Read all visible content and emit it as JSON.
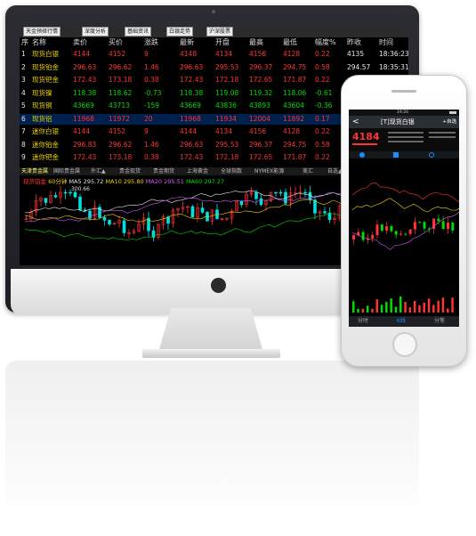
{
  "toolbar": {
    "buttons": [
      "天金预择行情",
      "深度分析",
      "基础资讯",
      "白银走势",
      "沪深股票"
    ]
  },
  "table": {
    "headers": [
      "序",
      "名称",
      "卖价",
      "买价",
      "涨跌",
      "最新",
      "开盘",
      "最高",
      "最低",
      "幅度%",
      "昨收",
      "时间"
    ],
    "rows": [
      {
        "idx": "1",
        "name": "现货白银",
        "ask": "4144",
        "bid": "4152",
        "chg": "9",
        "last": "4148",
        "open": "4134",
        "high": "4156",
        "low": "4128",
        "pct": "0.22",
        "prev": "4135",
        "time": "18:36:23"
      },
      {
        "idx": "2",
        "name": "现货铂金",
        "ask": "296.63",
        "bid": "296.62",
        "chg": "1.46",
        "last": "296.63",
        "open": "295.53",
        "high": "296.37",
        "low": "294.75",
        "pct": "0.58",
        "prev": "294.57",
        "time": "18:35:31"
      },
      {
        "idx": "3",
        "name": "现货钯金",
        "ask": "172.43",
        "bid": "173.18",
        "chg": "0.38",
        "last": "172.43",
        "open": "172.18",
        "high": "172.65",
        "low": "171.87",
        "pct": "0.22",
        "prev": "",
        "time": ""
      },
      {
        "idx": "4",
        "name": "现货镍",
        "ask": "118.38",
        "bid": "118.62",
        "chg": "-0.73",
        "last": "118.38",
        "open": "119.08",
        "high": "119.32",
        "low": "118.06",
        "pct": "-0.61",
        "prev": "",
        "time": ""
      },
      {
        "idx": "5",
        "name": "现货铜",
        "ask": "43669",
        "bid": "43713",
        "chg": "-159",
        "last": "43669",
        "open": "43836",
        "high": "43893",
        "low": "43604",
        "pct": "-0.36",
        "prev": "",
        "time": ""
      },
      {
        "idx": "6",
        "name": "现货铝",
        "ask": "11968",
        "bid": "11972",
        "chg": "20",
        "last": "11968",
        "open": "11934",
        "high": "12004",
        "low": "11892",
        "pct": "0.17",
        "prev": "",
        "time": ""
      },
      {
        "idx": "7",
        "name": "迷你白银",
        "ask": "4144",
        "bid": "4152",
        "chg": "9",
        "last": "4144",
        "open": "4134",
        "high": "4156",
        "low": "4128",
        "pct": "0.22",
        "prev": "",
        "time": ""
      },
      {
        "idx": "8",
        "name": "迷你铂金",
        "ask": "296.83",
        "bid": "296.62",
        "chg": "1.46",
        "last": "296.63",
        "open": "295.53",
        "high": "296.37",
        "low": "294.75",
        "pct": "0.58",
        "prev": "",
        "time": ""
      },
      {
        "idx": "9",
        "name": "迷你钯金",
        "ask": "172.43",
        "bid": "173.18",
        "chg": "0.38",
        "last": "172.43",
        "open": "172.18",
        "high": "172.65",
        "low": "171.87",
        "pct": "0.22",
        "prev": "",
        "time": ""
      }
    ]
  },
  "tabs": [
    "天津贵金属",
    "国际贵金属",
    "外汇▲",
    "贵金现货",
    "贵金期货",
    "上海黄金",
    "全球指数",
    "NYMEX能源",
    "美汇",
    "自选▲"
  ],
  "chart": {
    "name": "现货铂金",
    "period": "60分钟",
    "ma5": "MA5 295.72",
    "ma10": "MA10 295.80",
    "ma20": "MA20 295.51",
    "ma60": "MA60 297.27",
    "hi_label": "300.66"
  },
  "phone": {
    "status_time": "19:20",
    "title": "[T]现货白银",
    "back_label": "<",
    "add_label": "+自选",
    "price": "4184",
    "bottom_tabs": [
      "分时",
      "K线",
      "分笔"
    ]
  },
  "colors": {
    "up": "#ff3333",
    "down": "#00dd00",
    "flat": "#e6e6e6",
    "accent": "#1e8cff"
  }
}
